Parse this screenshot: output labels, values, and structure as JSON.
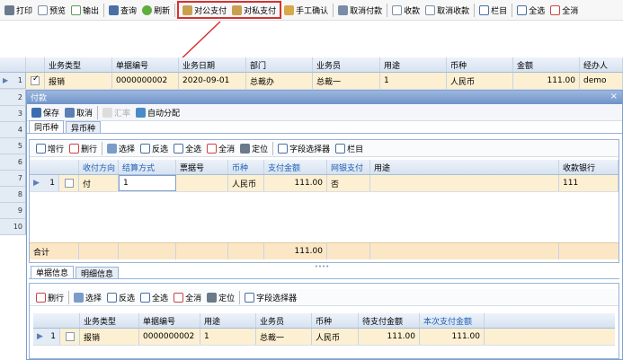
{
  "toolbar": {
    "print": "打印",
    "preview": "预览",
    "export": "输出",
    "query": "查询",
    "refresh": "刷新",
    "public_pay": "对公支付",
    "private_pay": "对私支付",
    "manual_confirm": "手工确认",
    "cancel_pay": "取消付款",
    "receive": "收款",
    "cancel_receive": "取消收款",
    "columns": "栏目",
    "select_all": "全选",
    "clear_all": "全消"
  },
  "main_grid": {
    "headers": [
      "业务类型",
      "单据编号",
      "业务日期",
      "部门",
      "业务员",
      "用途",
      "币种",
      "金额",
      "经办人"
    ],
    "rows": [
      {
        "num": "1",
        "type": "报销",
        "code": "0000000002",
        "date": "2020-09-01",
        "dept": "总裁办",
        "staff": "总裁一",
        "use": "1",
        "currency": "人民币",
        "amount": "111.00",
        "handler": "demo"
      }
    ],
    "row_numbers": [
      "2",
      "3",
      "4",
      "5",
      "6",
      "7",
      "8",
      "9",
      "10"
    ]
  },
  "dialog": {
    "title": "付款",
    "close": "×",
    "bar": {
      "save": "保存",
      "cancel": "取消",
      "exchange": "汇率",
      "auto_assign": "自动分配"
    },
    "tabs": [
      "同币种",
      "异币种"
    ],
    "pay_bar": {
      "add": "增行",
      "delete": "删行",
      "select": "选择",
      "invert": "反选",
      "select_all": "全选",
      "clear_all": "全消",
      "locate": "定位",
      "field_selector": "字段选择器",
      "columns": "栏目"
    },
    "pay_grid": {
      "headers": [
        "收付方向",
        "结算方式",
        "票据号",
        "币种",
        "支付金额",
        "网银支付",
        "用途",
        "收款银行"
      ],
      "row": {
        "num": "1",
        "direction": "付",
        "method": "1",
        "bill": "",
        "currency": "人民币",
        "amount": "111.00",
        "online": "否",
        "use": "",
        "bank": "111"
      },
      "total_label": "合计",
      "total_amount": "111.00"
    },
    "lower_tabs": [
      "单据信息",
      "明细信息"
    ],
    "doc_bar": {
      "delete": "删行",
      "select": "选择",
      "invert": "反选",
      "select_all": "全选",
      "clear_all": "全消",
      "locate": "定位",
      "field_selector": "字段选择器"
    },
    "doc_grid": {
      "headers": [
        "业务类型",
        "单据编号",
        "用途",
        "业务员",
        "币种",
        "待支付金额",
        "本次支付金额"
      ],
      "row": {
        "num": "1",
        "type": "报销",
        "code": "0000000002",
        "use": "1",
        "staff": "总裁一",
        "currency": "人民币",
        "pending": "111.00",
        "current": "111.00"
      }
    }
  },
  "colors": {
    "highlight": "#d83030",
    "header_blue": "#1d5fb3",
    "total_row": "#fbe7c6",
    "selected_row": "#fdf0d2"
  }
}
